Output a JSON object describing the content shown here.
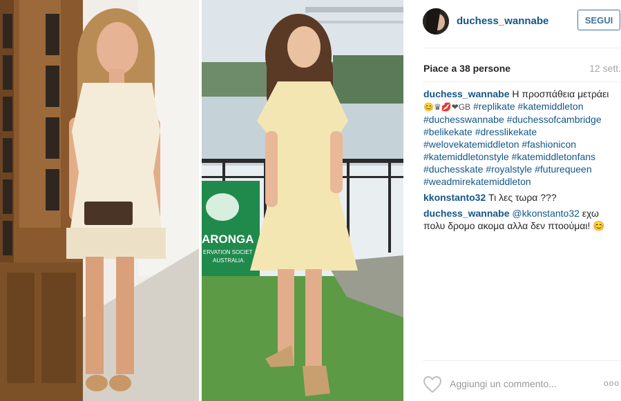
{
  "post": {
    "username": "duchess_wannabe",
    "follow_label": "SEGUI",
    "likes": "Piace a 38 persone",
    "date": "12 sett."
  },
  "comments": [
    {
      "user": "duchess_wannabe",
      "text": "Η προσπάθεια μετράει",
      "emoji": "😊♛💋❤GB",
      "hashtags": [
        "#replikate",
        "#katemiddleton",
        "#duchesswannabe",
        "#duchessofcambridge",
        "#belikekate",
        "#dresslikekate",
        "#welovekatemiddleton",
        "#fashionicon",
        "#katemiddletonstyle",
        "#katemiddletonfans",
        "#duchesskate",
        "#royalstyle",
        "#futurequeen",
        "#weadmirekatemiddleton"
      ]
    },
    {
      "user": "kkonstanto32",
      "text": "Τι λες τωρα ???"
    },
    {
      "user": "duchess_wannabe",
      "mention": "@kkonstanto32",
      "text": "εχω πολυ δρομο ακομα αλλα δεν πτοούμαι! 😊"
    }
  ],
  "footer": {
    "add_comment_placeholder": "Aggiungi un commento...",
    "more_label": "ooo",
    "icons": {
      "like": "heart-icon",
      "more": "more-options-icon"
    }
  },
  "images": {
    "sign_text_1": "ARONGA",
    "sign_text_2": "ERVATION SOCIET",
    "sign_text_3": "AUSTRALIA."
  },
  "colors": {
    "link": "#125688",
    "follow": "#3f729b",
    "muted": "#999999"
  }
}
